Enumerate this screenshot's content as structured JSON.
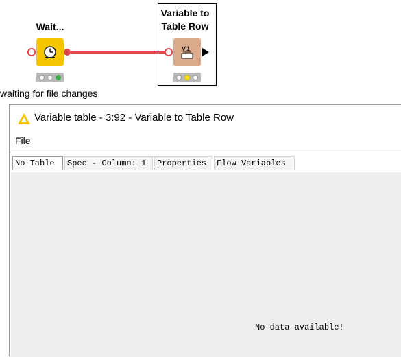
{
  "workflow": {
    "node_wait": {
      "title": "Wait...",
      "status": "waiting for file changes",
      "icon": "clock-icon",
      "color": "#f7c500"
    },
    "node_var": {
      "title_line1": "Variable to",
      "title_line2": "Table Row",
      "icon": "variable-to-table-icon",
      "color": "#dba98c"
    },
    "connection_color": "#e0474c"
  },
  "dialog": {
    "title": "Variable table - 3:92 - Variable to Table Row",
    "icon": "warning-triangle-icon",
    "menu": {
      "file": "File"
    },
    "tabs": [
      "No Table",
      "Spec - Column: 1",
      "Properties",
      "Flow Variables"
    ],
    "active_tab": "No Table",
    "empty_message": "No data available!"
  }
}
